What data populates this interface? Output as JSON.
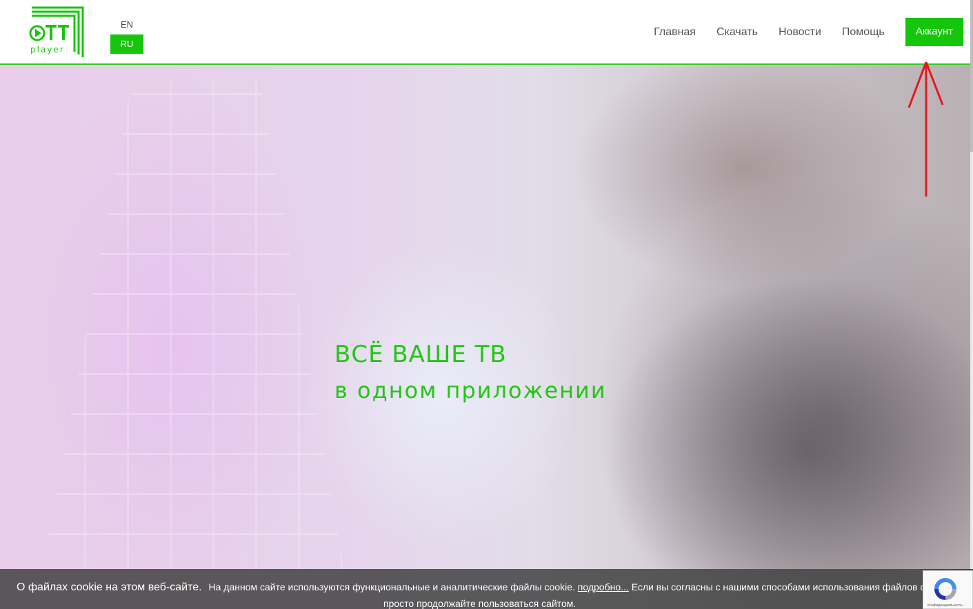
{
  "header": {
    "logo": {
      "text": "OTT",
      "subtext": "player"
    },
    "languages": {
      "en": "EN",
      "ru": "RU",
      "active": "RU"
    },
    "nav": [
      {
        "label": "Главная"
      },
      {
        "label": "Скачать"
      },
      {
        "label": "Новости"
      },
      {
        "label": "Помощь"
      }
    ],
    "account_label": "Аккаунт"
  },
  "hero": {
    "title": "ВСЁ ВАШЕ ТВ",
    "subtitle": "в одном приложении"
  },
  "cookie": {
    "title": "О файлах cookie на этом веб-сайте.",
    "text_before_link": "На данном сайте используются функциональные и аналитические файлы cookie.",
    "link": "подробно...",
    "text_after_link": "Если вы согласны с нашими способами использования файлов cookie,",
    "text_line2": "просто продолжайте пользоваться сайтом."
  },
  "recaptcha": {
    "text": "Конфиденциальность -"
  },
  "colors": {
    "brand_green": "#16c60c",
    "hero_text": "#22c614",
    "annotation_red": "#e3191f"
  }
}
